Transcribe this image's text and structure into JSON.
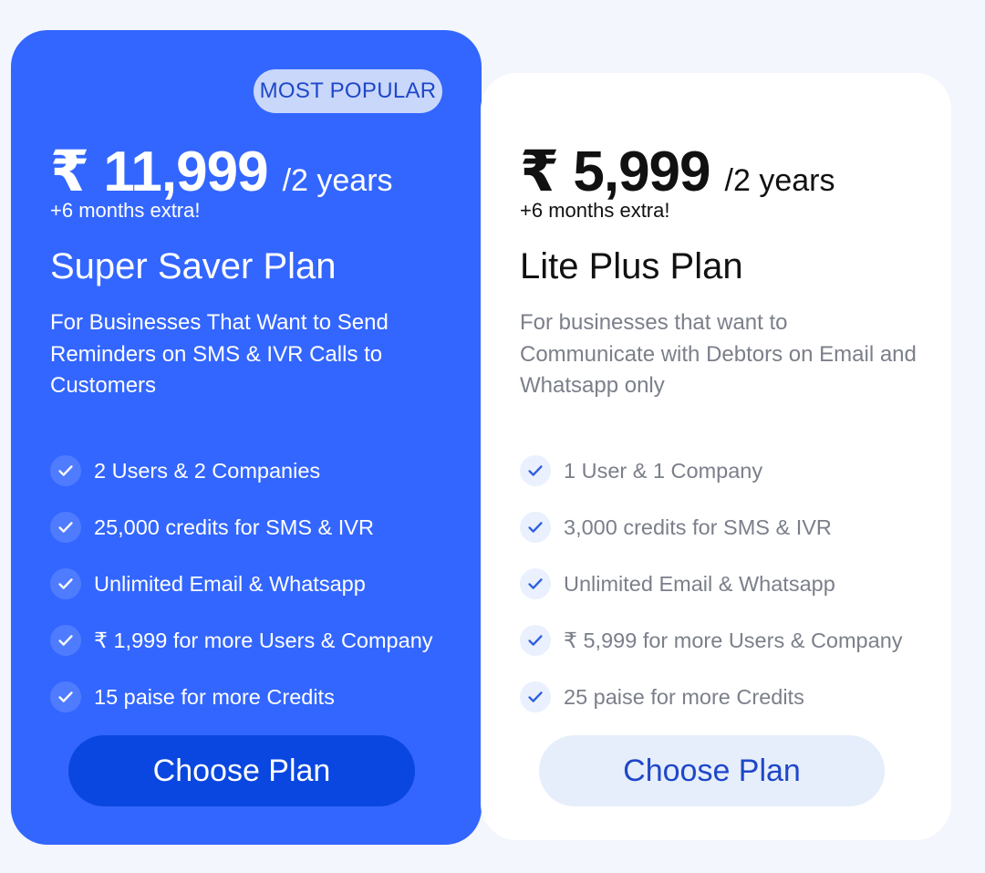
{
  "plans": [
    {
      "badge": "MOST POPULAR",
      "price": "₹ 11,999",
      "period": "/2 years",
      "extra": "+6 months extra!",
      "name": "Super Saver Plan",
      "description": "For Businesses That Want to Send Reminders on SMS & IVR Calls to Customers",
      "features": [
        "2 Users & 2 Companies",
        "25,000 credits for SMS & IVR",
        "Unlimited Email & Whatsapp",
        "₹ 1,999 for more Users & Company",
        "15 paise for more Credits"
      ],
      "cta": "Choose Plan"
    },
    {
      "price": "₹ 5,999",
      "period": "/2 years",
      "extra": "+6 months extra!",
      "name": "Lite Plus Plan",
      "description": "For businesses that want to Communicate with Debtors on Email and Whatsapp only",
      "features": [
        "1 User & 1 Company",
        "3,000 credits for SMS & IVR",
        "Unlimited Email & Whatsapp",
        "₹ 5,999 for more Users & Company",
        "25 paise for more Credits"
      ],
      "cta": "Choose Plan"
    }
  ],
  "colors": {
    "featured_bg": "#3366ff",
    "featured_button": "#0a47e0",
    "badge_bg": "#c9d7fb",
    "accent_text": "#1f47c9",
    "page_bg": "#f3f6fc"
  },
  "icons": {
    "feature_bullet": "check-icon"
  }
}
